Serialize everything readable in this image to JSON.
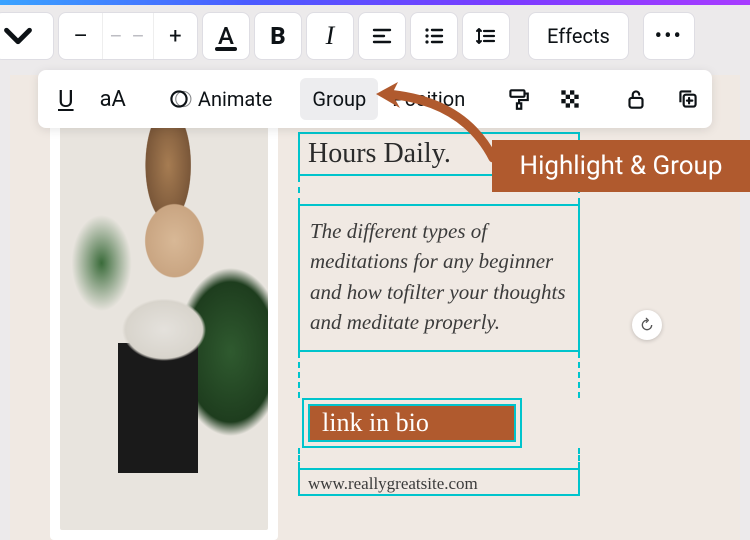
{
  "top_toolbar": {
    "font_size_placeholder": "– –",
    "effects_label": "Effects"
  },
  "toolbar2": {
    "animate_label": "Animate",
    "group_label": "Group",
    "position_label": "Position"
  },
  "content": {
    "hours_text": "Hours Daily.",
    "body_text": "The different types of meditations for any beginner and how tofilter your thoughts and meditate properly.",
    "link_label": "link in bio",
    "url_text": "www.reallygreatsite.com"
  },
  "annotation": {
    "label": "Highlight & Group"
  }
}
